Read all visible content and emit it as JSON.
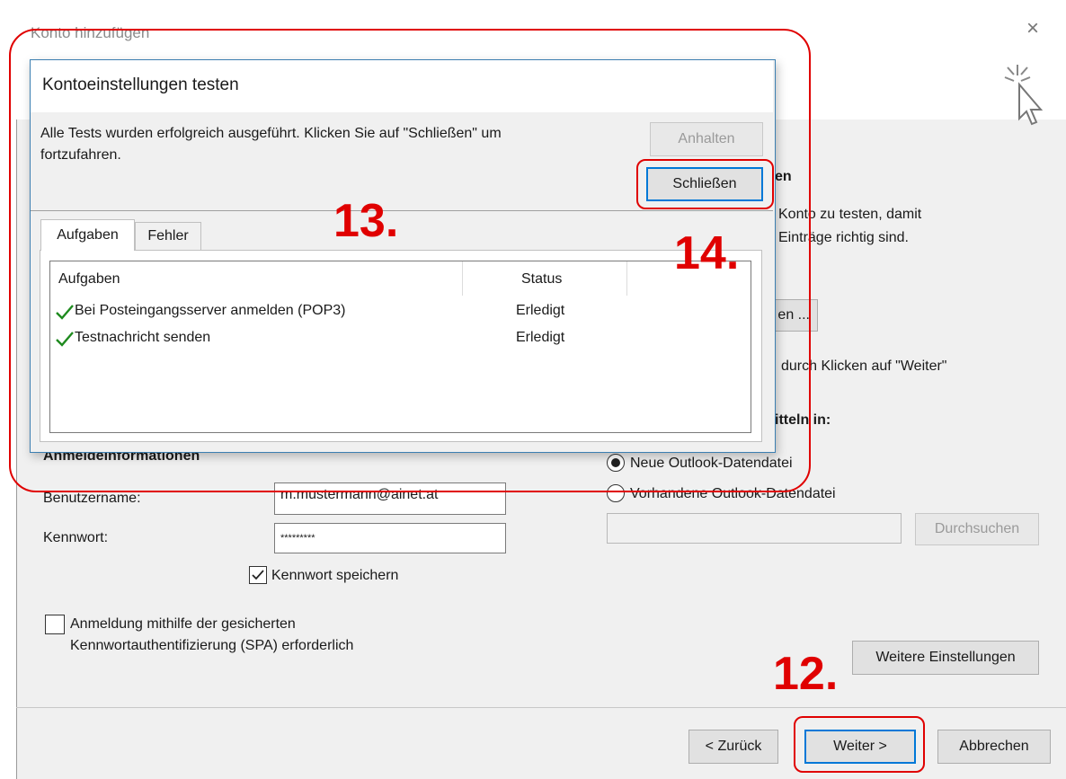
{
  "outer_window": {
    "title": "Konto hinzufügen",
    "close_glyph": "×",
    "right_panel": {
      "heading_partial": "en",
      "desc_line1": "Konto zu testen, damit",
      "desc_line2": "Einträge richtig sind.",
      "test_button_partial": "en ...",
      "auto_test_partial": "durch Klicken auf \"Weiter\"",
      "deliver_heading_partial": "itteln in:",
      "radio_new": "Neue Outlook-Datendatei",
      "radio_existing": "Vorhandene Outlook-Datendatei",
      "browse_button": "Durchsuchen",
      "more_settings_button": "Weitere Einstellungen"
    },
    "login": {
      "heading_partial": "Anmeldeinformationen",
      "username_label": "Benutzername:",
      "username_value": "m.mustermann@ainet.at",
      "password_label": "Kennwort:",
      "password_value": "*********",
      "save_password_label": "Kennwort speichern",
      "spa_line1": "Anmeldung mithilfe der gesicherten",
      "spa_line2": "Kennwortauthentifizierung (SPA) erforderlich"
    },
    "footer": {
      "back_button": "< Zurück",
      "next_button": "Weiter >",
      "cancel_button": "Abbrechen"
    }
  },
  "dialog": {
    "title": "Kontoeinstellungen testen",
    "message_line1": "Alle Tests wurden erfolgreich ausgeführt. Klicken Sie auf \"Schließen\" um",
    "message_line2": "fortzufahren.",
    "stop_button": "Anhalten",
    "close_button": "Schließen",
    "tabs": [
      {
        "label": "Aufgaben",
        "active": true
      },
      {
        "label": "Fehler",
        "active": false
      }
    ],
    "table": {
      "headers": [
        "Aufgaben",
        "Status"
      ],
      "rows": [
        {
          "task": "Bei Posteingangsserver anmelden (POP3)",
          "status": "Erledigt"
        },
        {
          "task": "Testnachricht senden",
          "status": "Erledigt"
        }
      ]
    }
  },
  "annotations": {
    "step_12": "12.",
    "step_13": "13.",
    "step_14": "14.",
    "color": "#e00000"
  },
  "colors": {
    "check_green": "#1e8a1e",
    "dialog_border": "#3c7fb1",
    "default_button_border": "#0078d7"
  }
}
